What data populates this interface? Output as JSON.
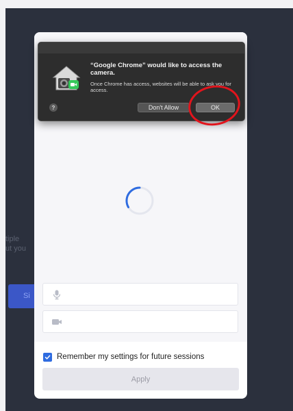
{
  "background": {
    "button_label": "Si",
    "text_line1": "tiple",
    "text_line2": "ut you"
  },
  "dialog": {
    "title": "“Google Chrome” would like to access the camera.",
    "message": "Once Chrome has access, websites will be able to ask you for access.",
    "help_label": "?",
    "dont_allow_label": "Don't Allow",
    "ok_label": "OK"
  },
  "panel": {
    "microphone_icon": "microphone-icon",
    "camera_icon": "camera-icon",
    "remember_label": "Remember my settings for future sessions",
    "remember_checked": true,
    "apply_label": "Apply"
  },
  "colors": {
    "annotation_ring": "#e2141c",
    "checkbox": "#2f6ce0",
    "spinner": "#2f6ce0"
  }
}
